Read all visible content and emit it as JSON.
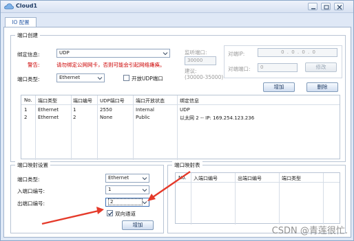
{
  "window": {
    "title": "Cloud1"
  },
  "tabs": [
    {
      "label": "IO 配置"
    }
  ],
  "port_create": {
    "group_title": "端口创建",
    "bind_label": "绑定信息:",
    "bind_value": "UDP",
    "warning_label": "警告:",
    "warning_text": "请勿绑定公网网卡，否则可能会引起网络瘫痪。",
    "listen_port_label": "监听端口:",
    "listen_port_value": "30000",
    "suggest_label": "建议:",
    "suggest_range": "(30000-35000)",
    "peer_ip_label": "对端IP:",
    "peer_ip_value": "0 . 0 . 0 . 0",
    "peer_port_label": "对端端口:",
    "peer_port_value": "0",
    "modify_button": "修改",
    "port_type_label": "端口类型:",
    "port_type_value": "Ethernet",
    "open_udp_label": "开放UDP端口",
    "add_button": "增加",
    "delete_button": "删除",
    "table": {
      "headers": [
        "No.",
        "端口类型",
        "端口编号",
        "UDP端口号",
        "端口开放状态",
        "绑定信息"
      ],
      "rows": [
        [
          "1",
          "Ethernet",
          "1",
          "2550",
          "Internal",
          "UDP"
        ],
        [
          "2",
          "Ethernet",
          "2",
          "None",
          "Public",
          "以太网 2 -- IP: 169.254.123.236"
        ]
      ]
    }
  },
  "port_mapping_settings": {
    "group_title": "端口映射设置",
    "port_type_label": "端口类型:",
    "port_type_value": "Ethernet",
    "in_port_label": "入端口编号:",
    "in_port_value": "1",
    "out_port_label": "出端口编号:",
    "out_port_value": "2",
    "bidirectional_label": "双向通道",
    "bidirectional_checked": true,
    "add_button": "增加"
  },
  "port_mapping_table": {
    "group_title": "端口映射表",
    "headers": [
      "No.",
      "入端口编号",
      "出端口编号",
      "端口类型"
    ]
  },
  "watermark": "CSDN @青莲很忙.",
  "colors": {
    "accent_arrow": "#e53a2a",
    "warning": "#cc0000",
    "frame": "#dfe8f6"
  }
}
